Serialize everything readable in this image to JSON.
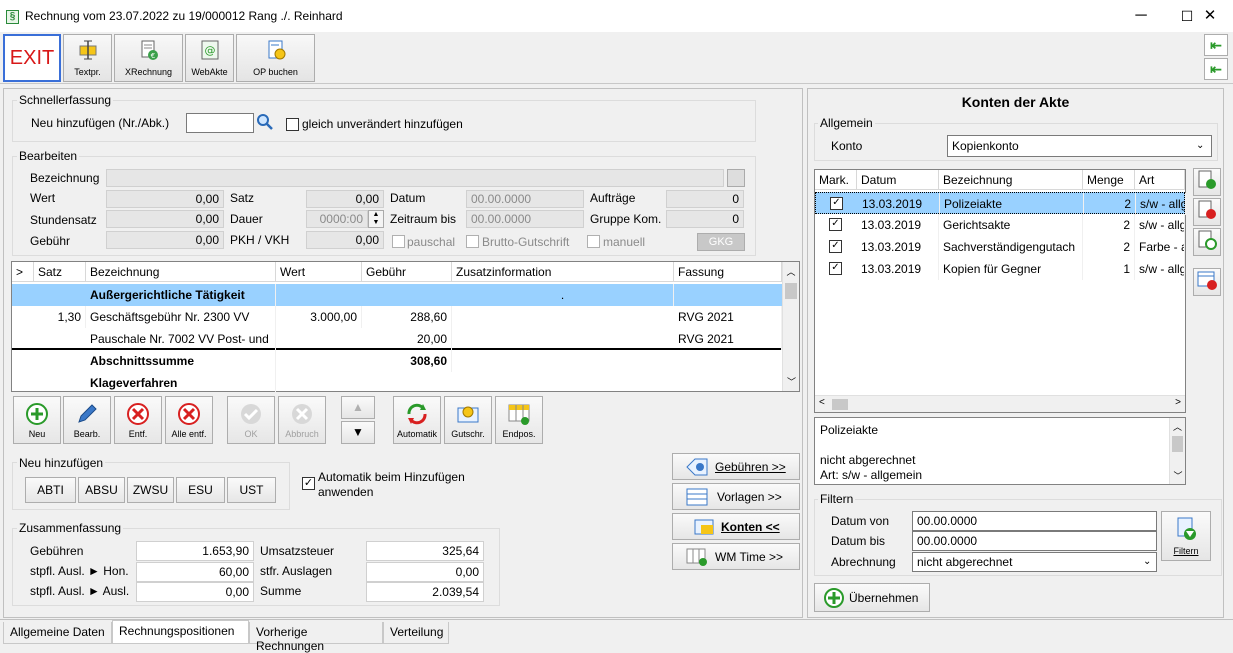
{
  "window": {
    "title": "Rechnung vom 23.07.2022 zu 19/000012  Rang ./. Reinhard",
    "minimize": "─",
    "maximize": "☐",
    "close": "✕"
  },
  "toolbar": {
    "exit": "EXIT",
    "textpr": "Textpr.",
    "xrechnung": "XRechnung",
    "webakte": "WebAkte",
    "op_buchen": "OP buchen"
  },
  "schnell": {
    "title": "Schnellerfassung",
    "neu_label": "Neu hinzufügen (Nr./Abk.)",
    "neu_value": "",
    "gleich_label": "gleich unverändert hinzufügen"
  },
  "bearbeiten": {
    "title": "Bearbeiten",
    "bezeichnung_label": "Bezeichnung",
    "bezeichnung_value": "",
    "wert_label": "Wert",
    "wert_value": "0,00",
    "stundensatz_label": "Stundensatz",
    "stundensatz_value": "0,00",
    "gebuehr_label": "Gebühr",
    "gebuehr_value": "0,00",
    "satz_label": "Satz",
    "satz_value": "0,00",
    "dauer_label": "Dauer",
    "dauer_value": "0000:00",
    "pkh_label": "PKH / VKH",
    "pkh_value": "0,00",
    "datum_label": "Datum",
    "datum_value": "00.00.0000",
    "zeitraum_label": "Zeitraum bis",
    "zeitraum_value": "00.00.0000",
    "pauschal_label": "pauschal",
    "brutto_label": "Brutto-Gutschrift",
    "manuell_label": "manuell",
    "auftraege_label": "Aufträge",
    "auftraege_value": "0",
    "gruppe_label": "Gruppe Kom.",
    "gruppe_value": "0",
    "gkg_label": "GKG"
  },
  "positions": {
    "headers": [
      ">",
      "Satz",
      "Bezeichnung",
      "Wert",
      "Gebühr",
      "Zusatzinformation",
      "Fassung"
    ],
    "rows": [
      {
        "sel": "",
        "satz": "",
        "bez": "Außergerichtliche Tätigkeit",
        "wert": "",
        "gebuehr": "",
        "zusatz": ".",
        "fassung": ""
      },
      {
        "sel": "",
        "satz": "1,30",
        "bez": "Geschäftsgebühr Nr. 2300 VV",
        "wert": "3.000,00",
        "gebuehr": "288,60",
        "zusatz": "",
        "fassung": "RVG 2021"
      },
      {
        "sel": "",
        "satz": "",
        "bez": "Pauschale Nr. 7002 VV Post- und",
        "wert": "",
        "gebuehr": "20,00",
        "zusatz": "",
        "fassung": "RVG 2021"
      },
      {
        "sel": "",
        "satz": "",
        "bez": "Abschnittssumme",
        "wert": "",
        "gebuehr": "308,60",
        "zusatz": "",
        "fassung": ""
      },
      {
        "sel": "",
        "satz": "",
        "bez": "Klageverfahren",
        "wert": "",
        "gebuehr": "",
        "zusatz": "",
        "fassung": ""
      }
    ]
  },
  "actions": {
    "neu": "Neu",
    "bearb": "Bearb.",
    "entf": "Entf.",
    "alle_entf": "Alle entf.",
    "ok": "OK",
    "abbruch": "Abbruch",
    "automatik": "Automatik",
    "gutschr": "Gutschr.",
    "endpos": "Endpos."
  },
  "neu_hinzufuegen": {
    "title": "Neu hinzufügen",
    "buttons": [
      "ABTI",
      "ABSU",
      "ZWSU",
      "ESU",
      "UST"
    ],
    "auto_label": "Automatik beim Hinzufügen anwenden"
  },
  "side_buttons": {
    "gebuehren": "Gebühren >>",
    "vorlagen": "Vorlagen >>",
    "konten": "Konten <<",
    "wmtime": "WM Time >>"
  },
  "summary": {
    "title": "Zusammenfassung",
    "gebuehren_label": "Gebühren",
    "gebuehren_value": "1.653,90",
    "hon_label": "stpfl. Ausl. ► Hon.",
    "hon_value": "60,00",
    "ausl_label": "stpfl. Ausl. ► Ausl.",
    "ausl_value": "0,00",
    "ust_label": "Umsatzsteuer",
    "ust_value": "325,64",
    "stfr_label": "stfr. Auslagen",
    "stfr_value": "0,00",
    "summe_label": "Summe",
    "summe_value": "2.039,54"
  },
  "konten": {
    "title": "Konten der Akte",
    "allgemein": "Allgemein",
    "konto_label": "Konto",
    "konto_value": "Kopienkonto",
    "headers": [
      "Mark.",
      "Datum",
      "Bezeichnung",
      "Menge",
      "Art"
    ],
    "rows": [
      {
        "datum": "13.03.2019",
        "bez": "Polizeiakte",
        "menge": "2",
        "art": "s/w - allg"
      },
      {
        "datum": "13.03.2019",
        "bez": "Gerichtsakte",
        "menge": "2",
        "art": "s/w - allg"
      },
      {
        "datum": "13.03.2019",
        "bez": "Sachverständigengutach",
        "menge": "2",
        "art": "Farbe - a"
      },
      {
        "datum": "13.03.2019",
        "bez": "Kopien für Gegner",
        "menge": "1",
        "art": "s/w - allg"
      }
    ],
    "detail_lines": [
      "Polizeiakte",
      "",
      "nicht abgerechnet",
      "Art: s/w - allgemein"
    ],
    "filter_title": "Filtern",
    "datum_von_label": "Datum von",
    "datum_von_value": "00.00.0000",
    "datum_bis_label": "Datum bis",
    "datum_bis_value": "00.00.0000",
    "abrechnung_label": "Abrechnung",
    "abrechnung_value": "nicht abgerechnet",
    "filtern_btn": "Filtern",
    "uebernehmen_btn": "Übernehmen"
  },
  "tabs": [
    "Allgemeine Daten",
    "Rechnungspositionen",
    "Vorherige Rechnungen",
    "Verteilung"
  ],
  "colors": {
    "selection": "#99d1ff",
    "accent_green": "#2a9a2a",
    "exit_red": "#d81818",
    "disabled_gray": "#8a8a8a"
  }
}
